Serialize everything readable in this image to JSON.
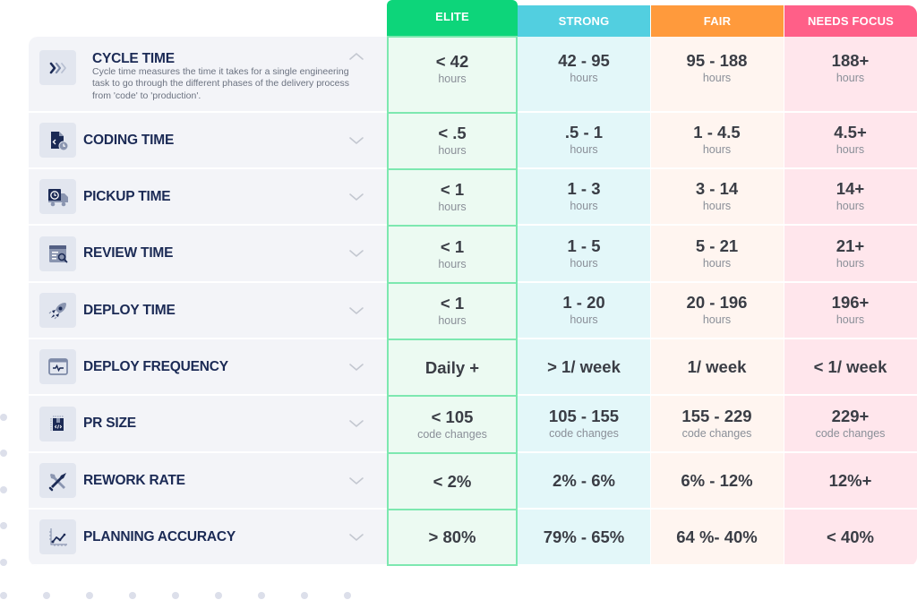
{
  "tiers": [
    {
      "key": "elite",
      "label": "ELITE",
      "color": "#0dd57a"
    },
    {
      "key": "strong",
      "label": "STRONG",
      "color": "#52cfe0"
    },
    {
      "key": "fair",
      "label": "FAIR",
      "color": "#ff9a3c"
    },
    {
      "key": "needs",
      "label": "NEEDS FOCUS",
      "color": "#ff5f88"
    }
  ],
  "metrics": [
    {
      "title": "CYCLE TIME",
      "icon": "chevrons-right-icon",
      "expanded": true,
      "description": "Cycle time measures the time it takes for a single engineering task to go through the different phases of the delivery process from 'code' to 'production'.",
      "unit": "hours",
      "values": [
        "< 42",
        "42 - 95",
        "95 - 188",
        "188+"
      ]
    },
    {
      "title": "CODING TIME",
      "icon": "code-file-clock-icon",
      "expanded": false,
      "unit": "hours",
      "values": [
        "< .5",
        ".5 - 1",
        "1 - 4.5",
        "4.5+"
      ]
    },
    {
      "title": "PICKUP TIME",
      "icon": "truck-clock-icon",
      "expanded": false,
      "unit": "hours",
      "values": [
        "< 1",
        "1 - 3",
        "3 - 14",
        "14+"
      ]
    },
    {
      "title": "REVIEW TIME",
      "icon": "document-search-icon",
      "expanded": false,
      "unit": "hours",
      "values": [
        "< 1",
        "1 - 5",
        "5 - 21",
        "21+"
      ]
    },
    {
      "title": "DEPLOY TIME",
      "icon": "rocket-icon",
      "expanded": false,
      "unit": "hours",
      "values": [
        "< 1",
        "1 - 20",
        "20 - 196",
        "196+"
      ]
    },
    {
      "title": "DEPLOY FREQUENCY",
      "icon": "monitor-pulse-icon",
      "expanded": false,
      "unit": "",
      "values": [
        "Daily +",
        "> 1/ week",
        "1/ week",
        "< 1/ week"
      ]
    },
    {
      "title": "PR SIZE",
      "icon": "code-box-icon",
      "expanded": false,
      "unit": "code changes",
      "values": [
        "< 105",
        "105 - 155",
        "155 - 229",
        "229+"
      ]
    },
    {
      "title": "REWORK RATE",
      "icon": "wrench-screwdriver-icon",
      "expanded": false,
      "unit": "",
      "values": [
        "< 2%",
        "2% - 6%",
        "6% - 12%",
        "12%+"
      ]
    },
    {
      "title": "PLANNING ACCURACY",
      "icon": "line-chart-icon",
      "expanded": false,
      "unit": "",
      "values": [
        "> 80%",
        "79% - 65%",
        "64 %- 40%",
        "< 40%"
      ]
    }
  ]
}
